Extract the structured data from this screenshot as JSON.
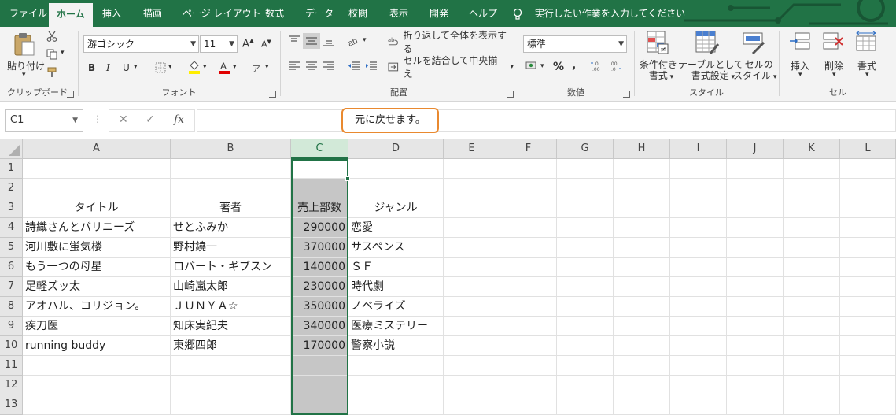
{
  "menu": {
    "tabs": [
      "ファイル",
      "ホーム",
      "挿入",
      "描画",
      "ページ レイアウト",
      "数式",
      "データ",
      "校閲",
      "表示",
      "開発",
      "ヘルプ"
    ],
    "active_tab": "ホーム",
    "tell_me": "実行したい作業を入力してください"
  },
  "ribbon": {
    "clipboard": {
      "paste": "貼り付け",
      "label": "クリップボード"
    },
    "font": {
      "name": "游ゴシック",
      "size": "11",
      "bold": "B",
      "italic": "I",
      "underline": "U",
      "label": "フォント"
    },
    "alignment": {
      "wrap_text": "折り返して全体を表示する",
      "merge_center": "セルを結合して中央揃え",
      "label": "配置"
    },
    "number": {
      "format": "標準",
      "percent": "%",
      "comma": ",",
      "label": "数値"
    },
    "styles": {
      "conditional": "条件付き\n書式",
      "conditional_1": "条件付き",
      "conditional_2": "書式",
      "table_1": "テーブルとして",
      "table_2": "書式設定",
      "cell_1": "セルの",
      "cell_2": "スタイル",
      "label": "スタイル"
    },
    "cells": {
      "insert": "挿入",
      "delete": "削除",
      "format": "書式",
      "label": "セル"
    }
  },
  "formula_bar": {
    "name_box": "C1",
    "fx": "fx",
    "callout": "元に戻せます。"
  },
  "sheet": {
    "columns": [
      "A",
      "B",
      "C",
      "D",
      "E",
      "F",
      "G",
      "H",
      "I",
      "J",
      "K",
      "L"
    ],
    "selected_column": "C",
    "rows": [
      "1",
      "2",
      "3",
      "4",
      "5",
      "6",
      "7",
      "8",
      "9",
      "10",
      "11",
      "12",
      "13"
    ],
    "headers": {
      "title": "タイトル",
      "author": "著者",
      "sales": "売上部数",
      "genre": "ジャンル"
    },
    "records": [
      {
        "title": "詩織さんとバリニーズ",
        "author": "せとふみか",
        "sales": "290000",
        "genre": "恋愛"
      },
      {
        "title": "河川敷に蛍気楼",
        "author": "野村鐃一",
        "sales": "370000",
        "genre": "サスペンス"
      },
      {
        "title": "もう一つの母星",
        "author": "ロバート・ギブスン",
        "sales": "140000",
        "genre": "ＳＦ"
      },
      {
        "title": "足軽ズッ太",
        "author": "山崎嵐太郎",
        "sales": "230000",
        "genre": "時代劇"
      },
      {
        "title": "アオハル、コリジョン。",
        "author": "ＪＵＮＹＡ☆",
        "sales": "350000",
        "genre": "ノベライズ"
      },
      {
        "title": "疾刀医",
        "author": "知床実紀夫",
        "sales": "340000",
        "genre": "医療ミステリー"
      },
      {
        "title": "running buddy",
        "author": "東郷四郎",
        "sales": "170000",
        "genre": "警察小説"
      }
    ]
  },
  "colors": {
    "accent": "#217346",
    "callout_border": "#e9892f",
    "selection_fill": "#c6c6c6"
  }
}
